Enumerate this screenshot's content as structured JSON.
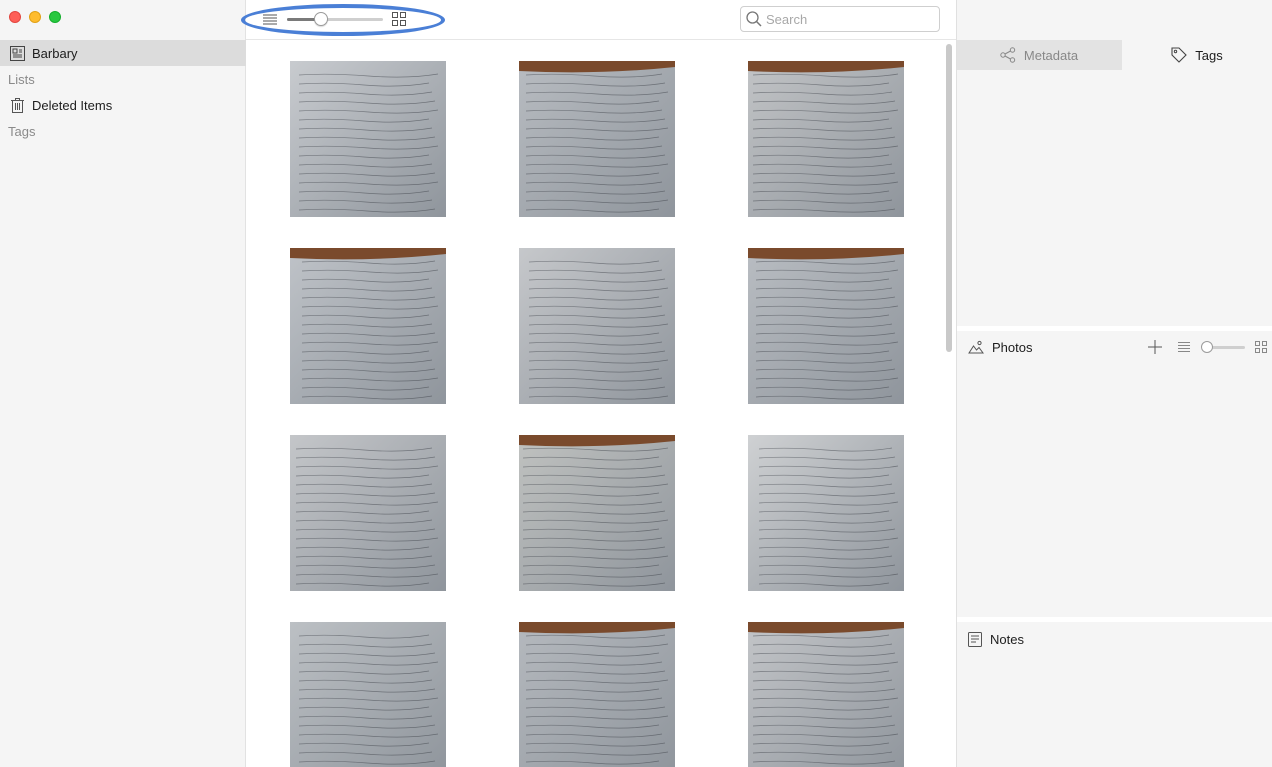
{
  "colors": {
    "sidebar_bg": "#f5f5f5",
    "selected_row": "#dcdcdc",
    "highlight_ring": "#4a7fd6",
    "right_panel_bg": "#f5f5f5"
  },
  "sidebar": {
    "library_name": "Barbary",
    "lists_header": "Lists",
    "deleted_items": "Deleted Items",
    "tags_header": "Tags"
  },
  "toolbar": {
    "search_placeholder": "Search",
    "thumbnail_size_fraction": 0.35
  },
  "grid": {
    "thumbnails": [
      {
        "icon": "manuscript-thumbnail"
      },
      {
        "icon": "manuscript-thumbnail"
      },
      {
        "icon": "manuscript-thumbnail"
      },
      {
        "icon": "manuscript-thumbnail"
      },
      {
        "icon": "manuscript-thumbnail"
      },
      {
        "icon": "manuscript-thumbnail"
      },
      {
        "icon": "manuscript-thumbnail"
      },
      {
        "icon": "manuscript-thumbnail"
      },
      {
        "icon": "manuscript-thumbnail"
      },
      {
        "icon": "manuscript-thumbnail"
      },
      {
        "icon": "manuscript-thumbnail"
      },
      {
        "icon": "manuscript-thumbnail"
      }
    ]
  },
  "right_panel": {
    "tab_metadata": "Metadata",
    "tab_tags": "Tags",
    "photos_label": "Photos",
    "notes_label": "Notes",
    "photos_size_fraction": 0.05
  }
}
